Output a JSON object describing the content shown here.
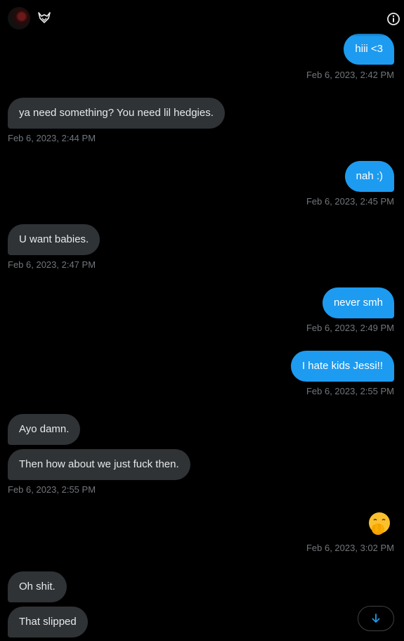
{
  "header": {
    "avatar_icon": "user-avatar",
    "badge_icon": "fox-emblem-icon",
    "info_icon": "info-icon"
  },
  "messages": [
    {
      "side": "sent",
      "text": "hiii <3",
      "time": "Feb 6, 2023, 2:42 PM"
    },
    {
      "side": "recv",
      "text": "ya need something? You need lil hedgies.",
      "time": "Feb 6, 2023, 2:44 PM"
    },
    {
      "side": "sent",
      "text": "nah :)",
      "time": "Feb 6, 2023, 2:45 PM"
    },
    {
      "side": "recv",
      "text": "U want babies.",
      "time": "Feb 6, 2023, 2:47 PM"
    },
    {
      "side": "sent",
      "text": "never smh",
      "time": "Feb 6, 2023, 2:49 PM"
    },
    {
      "side": "sent",
      "text": "I hate kids Jessi!!",
      "time": "Feb 6, 2023, 2:55 PM"
    },
    {
      "side": "recv",
      "text": "Ayo damn.",
      "time": ""
    },
    {
      "side": "recv",
      "text": "Then how about we just fuck then.",
      "time": "Feb 6, 2023, 2:55 PM"
    },
    {
      "side": "sent",
      "emoji": "face-with-hand-over-mouth",
      "time": "Feb 6, 2023, 3:02 PM"
    },
    {
      "side": "recv",
      "text": "Oh shit.",
      "time": ""
    },
    {
      "side": "recv",
      "text": "That slipped",
      "time": ""
    }
  ],
  "scroll_button": {
    "icon": "arrow-down-icon",
    "accent": "#1d9bf0"
  },
  "colors": {
    "sent_bubble": "#1d9bf0",
    "recv_bubble": "#2f3336",
    "timestamp": "#71767b",
    "background": "#000000"
  }
}
